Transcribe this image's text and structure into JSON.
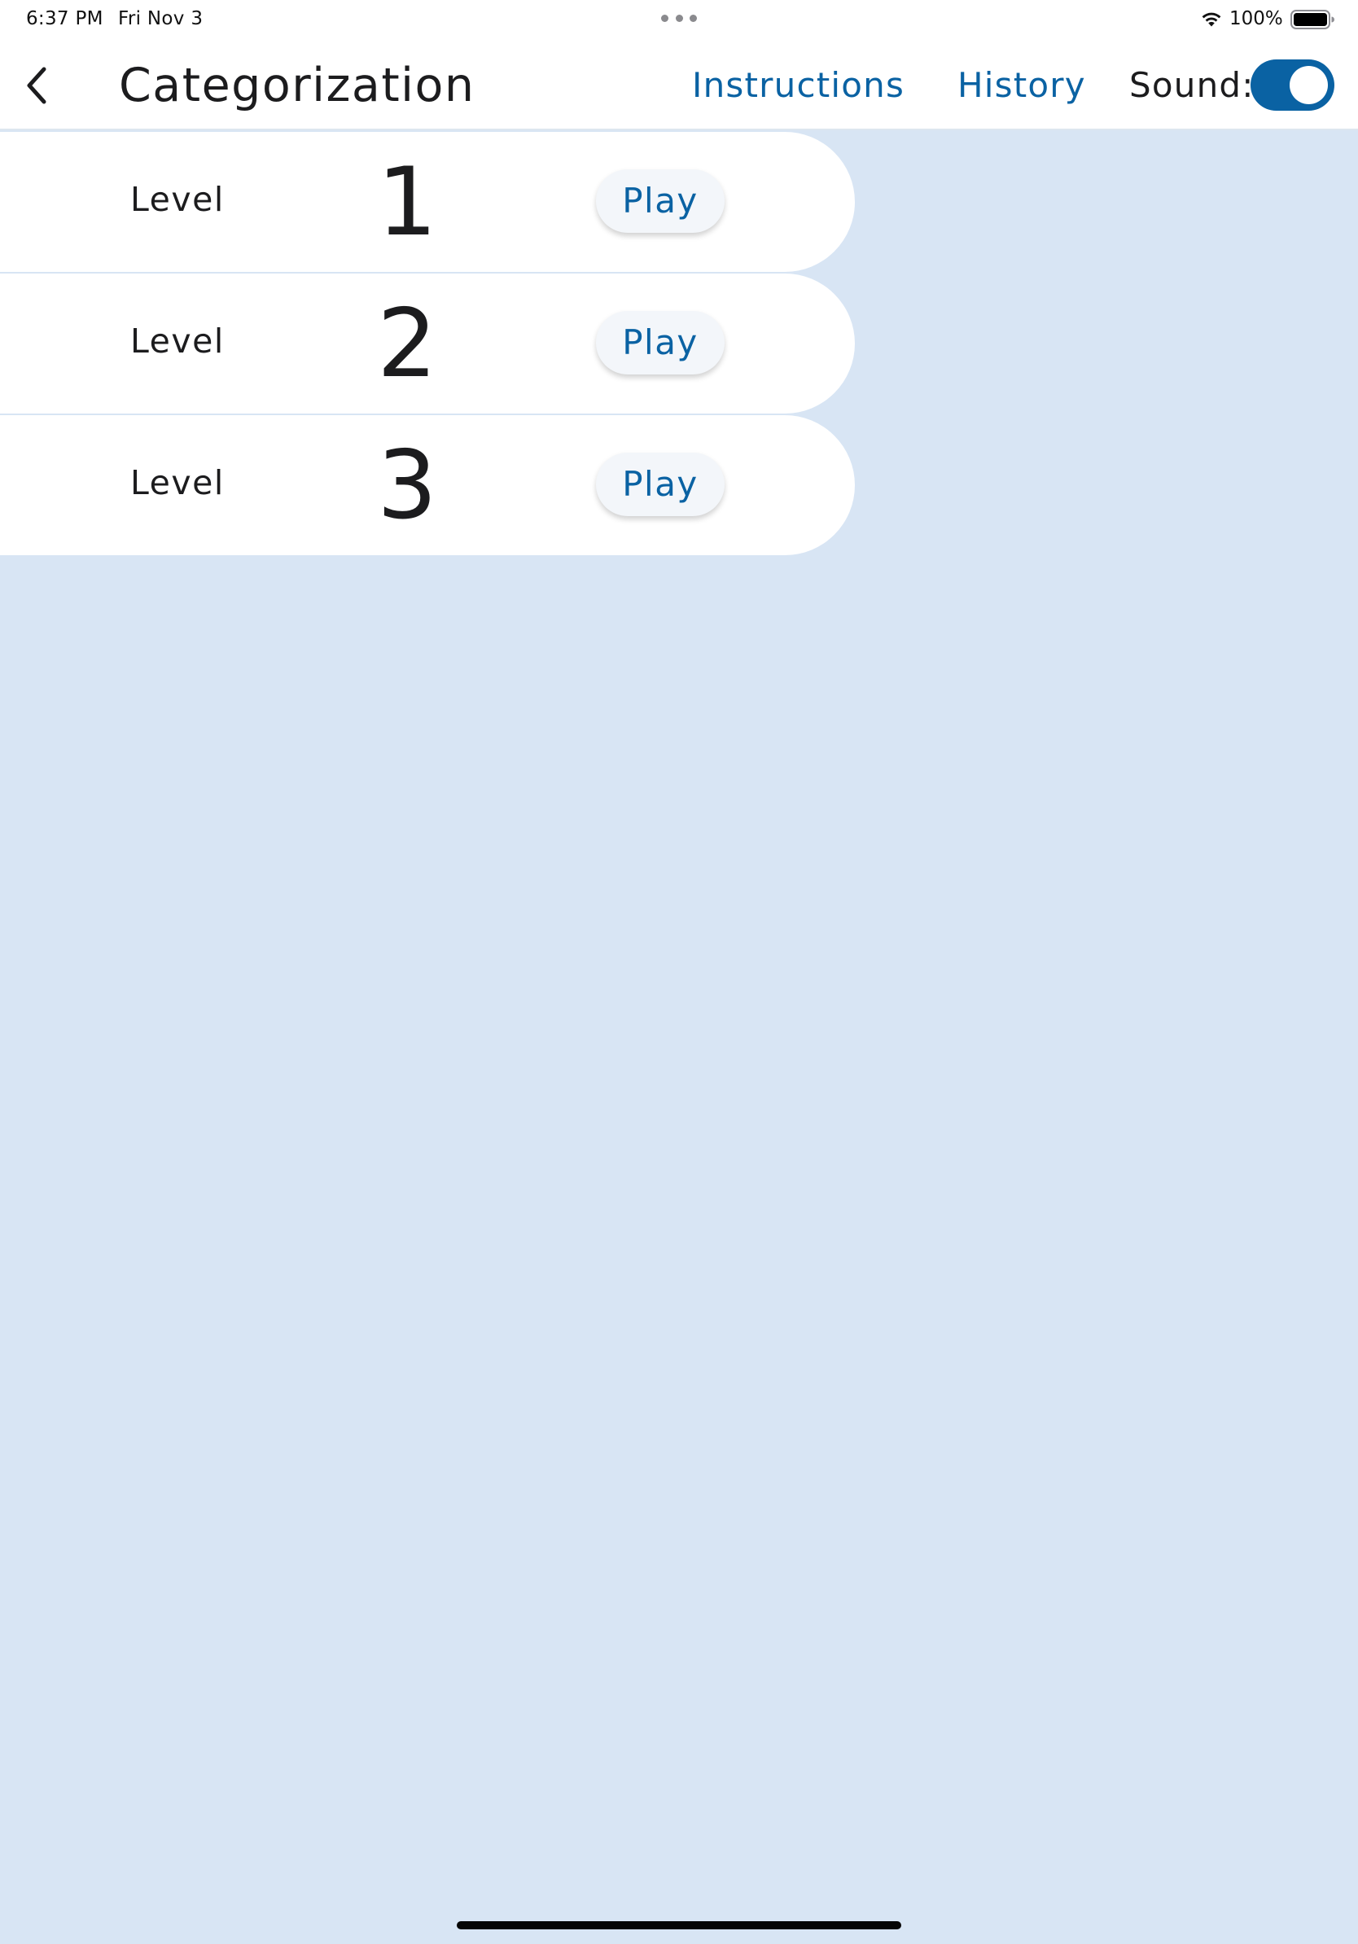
{
  "status_bar": {
    "time": "6:37 PM",
    "date": "Fri Nov 3",
    "battery_percent": "100%"
  },
  "header": {
    "title": "Categorization",
    "instructions_label": "Instructions",
    "history_label": "History",
    "sound_label": "Sound:",
    "sound_enabled": true
  },
  "levels": [
    {
      "label": "Level",
      "number": "1",
      "play_label": "Play"
    },
    {
      "label": "Level",
      "number": "2",
      "play_label": "Play"
    },
    {
      "label": "Level",
      "number": "3",
      "play_label": "Play"
    }
  ],
  "colors": {
    "accent": "#0a62a3",
    "background": "#d8e5f4",
    "surface": "#ffffff"
  },
  "icons": {
    "back": "chevron-left-icon",
    "wifi": "wifi-icon",
    "battery": "battery-icon",
    "multitask": "more-dots-icon"
  }
}
